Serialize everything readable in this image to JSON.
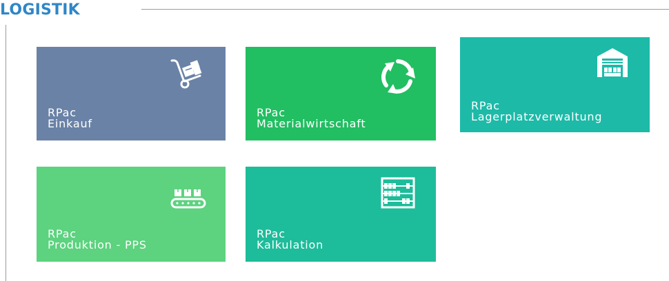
{
  "section": {
    "title": "LOGISTIK"
  },
  "colors": {
    "title": "#2f86c7",
    "rule": "#9a9a9a",
    "einkauf": "#6a82a6",
    "materialwirtschaft": "#22be62",
    "lagerplatzverwaltung": "#1dbaa8",
    "produktion": "#5dd27f",
    "kalkulation": "#1dbc9a"
  },
  "tiles": [
    {
      "line1": "RPac",
      "line2": "Einkauf",
      "icon": "hand-truck-boxes-icon"
    },
    {
      "line1": "RPac",
      "line2": "Materialwirtschaft",
      "icon": "recycle-arrows-icon"
    },
    {
      "line1": "RPac",
      "line2": "Lagerplatzverwaltung",
      "icon": "warehouse-icon"
    },
    {
      "line1": "RPac",
      "line2": "Produktion - PPS",
      "icon": "conveyor-belt-icon"
    },
    {
      "line1": "RPac",
      "line2": "Kalkulation",
      "icon": "abacus-icon"
    }
  ]
}
